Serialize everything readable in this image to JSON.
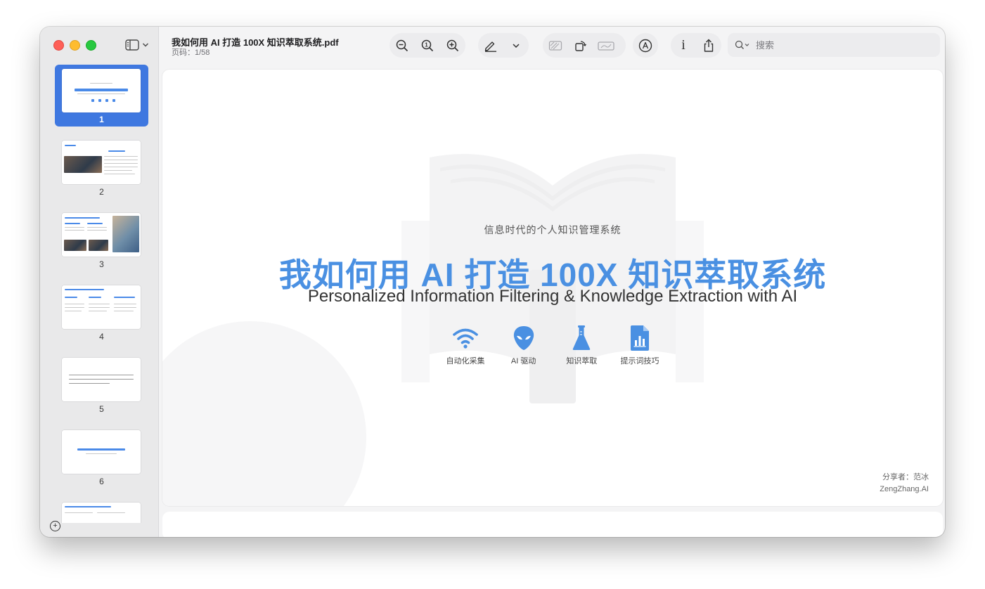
{
  "window": {
    "title": "我如何用 AI 打造 100X 知识萃取系统.pdf",
    "page_indicator": "页码：1/58"
  },
  "toolbar": {
    "zoom_out": "zoom-out-icon",
    "actual_size": "actual-size-icon",
    "zoom_in": "zoom-in-icon",
    "highlight": "pencil-highlight-icon",
    "rotate": "rotate-icon",
    "info_label": "i",
    "search_placeholder": "搜索"
  },
  "sidebar": {
    "thumbnails": [
      {
        "label": "1",
        "selected": true
      },
      {
        "label": "2",
        "selected": false
      },
      {
        "label": "3",
        "selected": false
      },
      {
        "label": "4",
        "selected": false
      },
      {
        "label": "5",
        "selected": false
      },
      {
        "label": "6",
        "selected": false
      }
    ]
  },
  "slide": {
    "subtitle": "信息时代的个人知识管理系统",
    "title": "我如何用 AI 打造 100X 知识萃取系统",
    "english_title": "Personalized Information Filtering & Knowledge Extraction with AI",
    "features": [
      {
        "label": "自动化采集",
        "icon": "wifi-icon"
      },
      {
        "label": "AI 驱动",
        "icon": "alien-icon"
      },
      {
        "label": "知识萃取",
        "icon": "flask-icon"
      },
      {
        "label": "提示词技巧",
        "icon": "document-chart-icon"
      }
    ],
    "credit_line1": "分享者：范冰",
    "credit_line2": "ZengZhang.AI",
    "accent_color": "#4a90e2"
  }
}
